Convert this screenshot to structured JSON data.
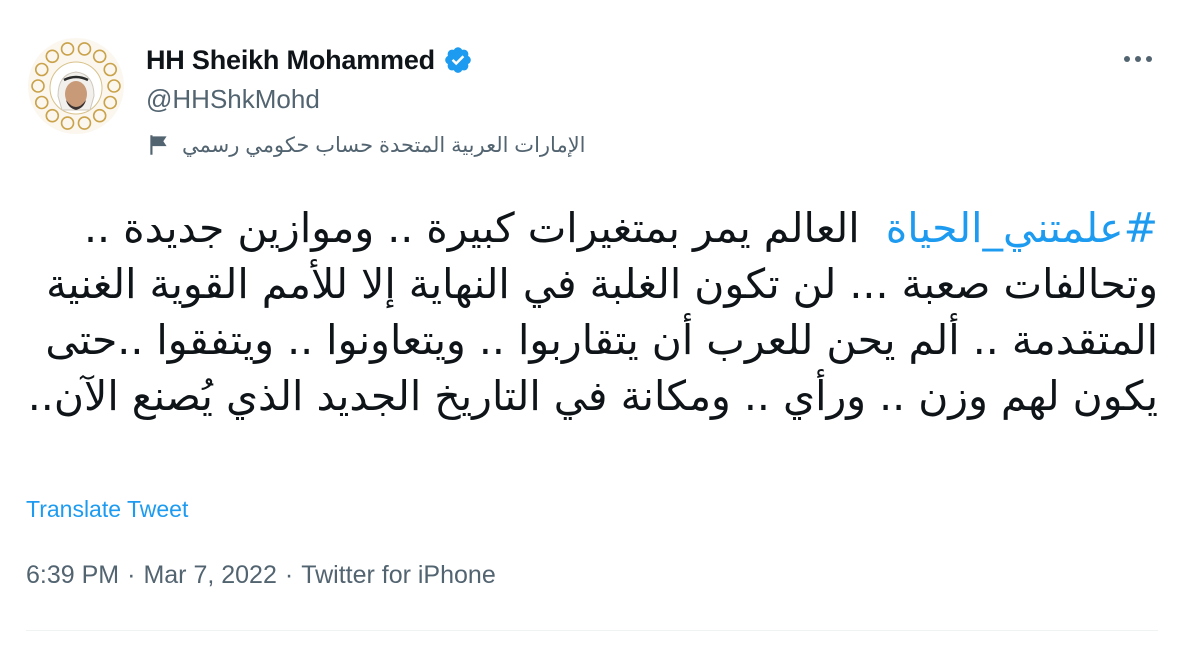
{
  "author": {
    "display_name": "HH Sheikh Mohammed",
    "handle": "@HHShkMohd",
    "avatar_icon": "profile-photo-with-ornamental-border",
    "verified_icon": "verified-badge-icon",
    "label": "الإمارات العربية المتحدة حساب حكومي رسمي",
    "label_icon": "flag-icon"
  },
  "menu": {
    "icon": "more-options-icon",
    "glyph": "•••"
  },
  "tweet": {
    "hashtag": "#علمتني_الحياة",
    "text": "العالم يمر بمتغيرات كبيرة .. وموازين جديدة .. وتحالفات صعبة ... لن تكون الغلبة في النهاية إلا للأمم القوية الغنية المتقدمة .. ألم يحن للعرب أن يتقاربوا .. ويتعاونوا .. ويتفقوا ..حتى يكون لهم وزن .. ورأي .. ومكانة في التاريخ الجديد الذي يُصنع الآن.."
  },
  "actions": {
    "translate_label": "Translate Tweet"
  },
  "meta": {
    "time": "6:39 PM",
    "separator": "·",
    "date": "Mar 7, 2022",
    "source": "Twitter for iPhone"
  },
  "colors": {
    "accent": "#1d9bf0",
    "text": "#0f1419",
    "secondary": "#536471",
    "divider": "#eff3f4",
    "avatar_border": "#c9a24a"
  }
}
